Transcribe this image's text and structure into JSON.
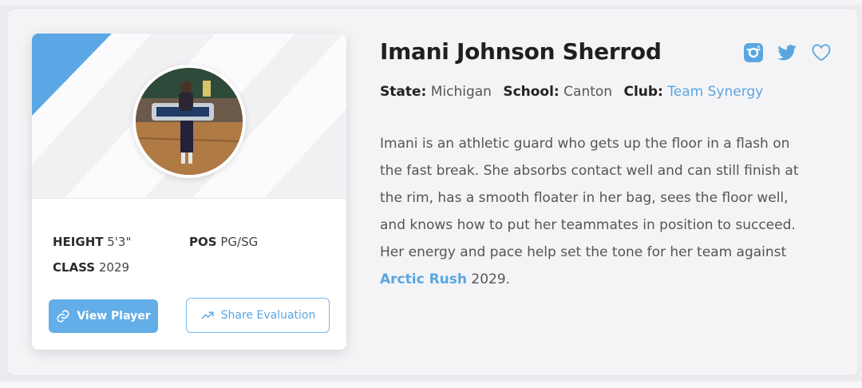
{
  "player": {
    "name": "Imani Johnson Sherrod",
    "photo_icon": "player-photo"
  },
  "stats": {
    "height_label": "HEIGHT",
    "height_value": "5'3\"",
    "pos_label": "POS",
    "pos_value": "PG/SG",
    "class_label": "CLASS",
    "class_value": "2029"
  },
  "buttons": {
    "view_player": "View Player",
    "share_evaluation": "Share Evaluation"
  },
  "meta": {
    "state_label": "State:",
    "state_value": "Michigan",
    "school_label": "School:",
    "school_value": "Canton",
    "club_label": "Club:",
    "club_value": "Team Synergy"
  },
  "bio": {
    "lines": [
      "Imani is an athletic guard who gets up the floor in a flash on",
      "the fast break. She absorbs contact well and can still finish at",
      "the rim, has a smooth floater in her bag, sees the floor well,",
      "and knows how to put her teammates in position to succeed.",
      "Her energy and pace help set the tone for her team against"
    ],
    "team_link": "Arctic Rush",
    "team_year": " 2029."
  },
  "icons": {
    "instagram": "instagram-icon",
    "twitter": "twitter-icon",
    "favorite": "heart-icon",
    "link": "link-icon",
    "share": "trend-arrow-icon"
  },
  "colors": {
    "accent": "#5aa6e0",
    "button_fill": "#63aee8",
    "corner_triangle": "#5ba7e6"
  }
}
